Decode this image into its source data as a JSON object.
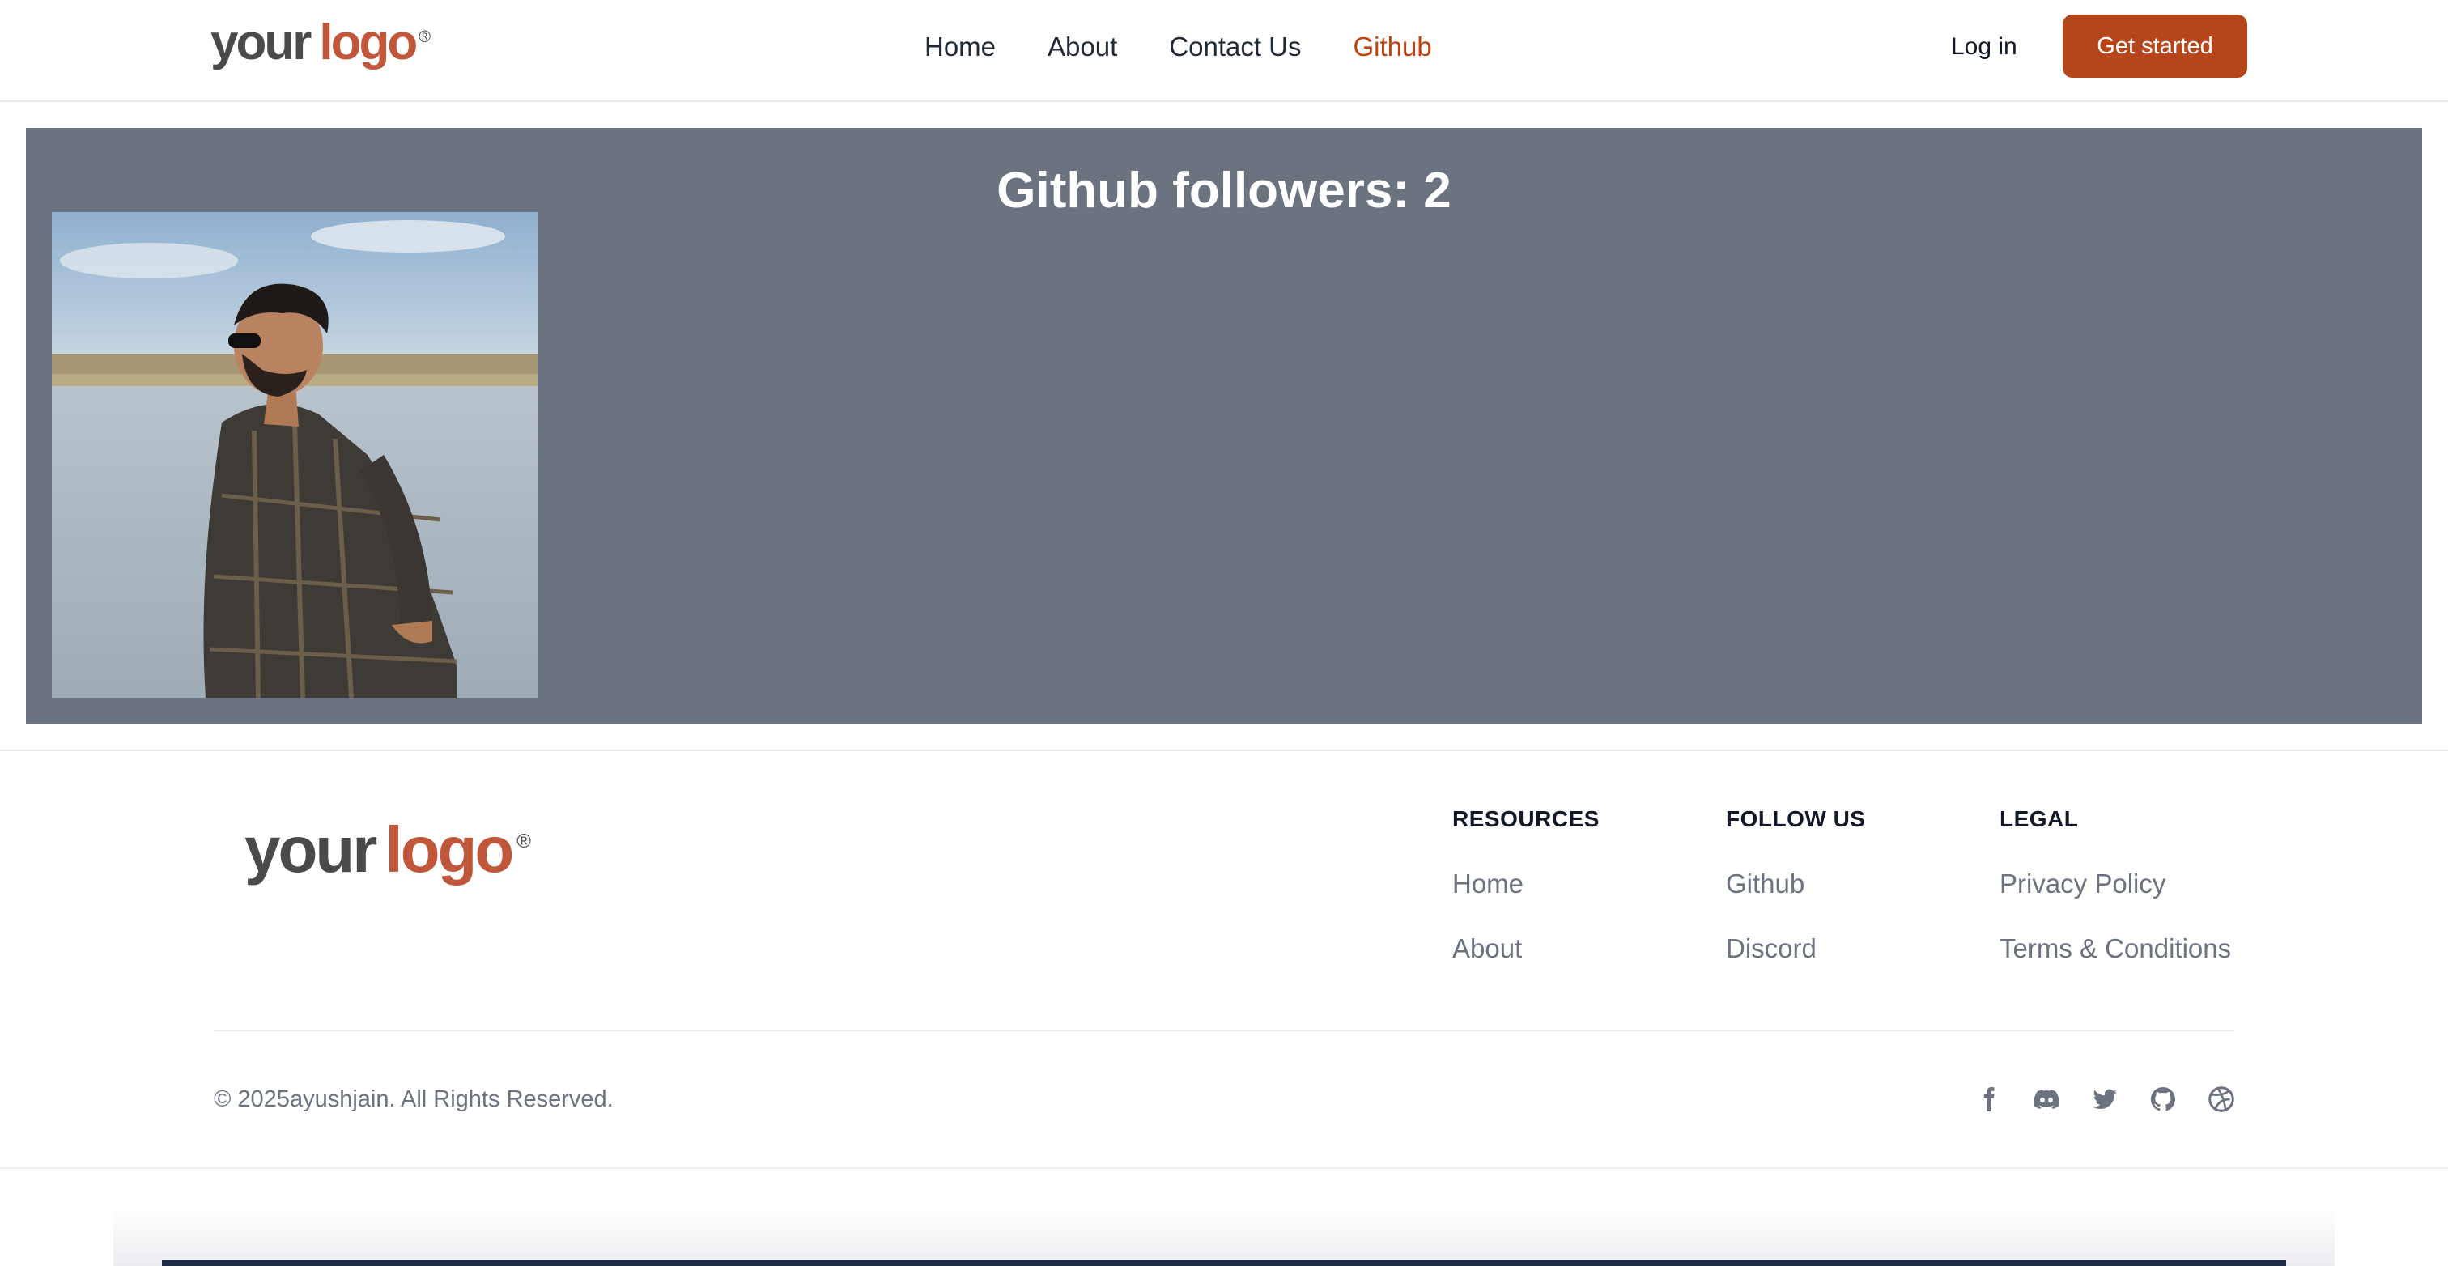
{
  "header": {
    "logo": {
      "word1": "your",
      "word2": "logo",
      "mark": "®"
    },
    "nav": [
      {
        "label": "Home",
        "active": false
      },
      {
        "label": "About",
        "active": false
      },
      {
        "label": "Contact Us",
        "active": false
      },
      {
        "label": "Github",
        "active": true
      }
    ],
    "login_label": "Log in",
    "cta_label": "Get started"
  },
  "main": {
    "title": "Github followers: 2",
    "avatar_icon": "profile-photo"
  },
  "footer": {
    "logo": {
      "word1": "your",
      "word2": "logo",
      "mark": "®"
    },
    "columns": [
      {
        "heading": "RESOURCES",
        "links": [
          "Home",
          "About"
        ]
      },
      {
        "heading": "FOLLOW US",
        "links": [
          "Github",
          "Discord"
        ]
      },
      {
        "heading": "LEGAL",
        "links": [
          "Privacy Policy",
          "Terms & Conditions"
        ]
      }
    ],
    "copyright": "© 2025ayushjain. All Rights Reserved.",
    "social_icons": [
      "facebook-icon",
      "discord-icon",
      "twitter-icon",
      "github-icon",
      "dribbble-icon"
    ]
  },
  "colors": {
    "brand": "#b5451b",
    "nav_active": "#c2410c",
    "card_bg": "#6b7280",
    "muted_text": "#6b7280",
    "logo_accent": "#c0573a"
  }
}
